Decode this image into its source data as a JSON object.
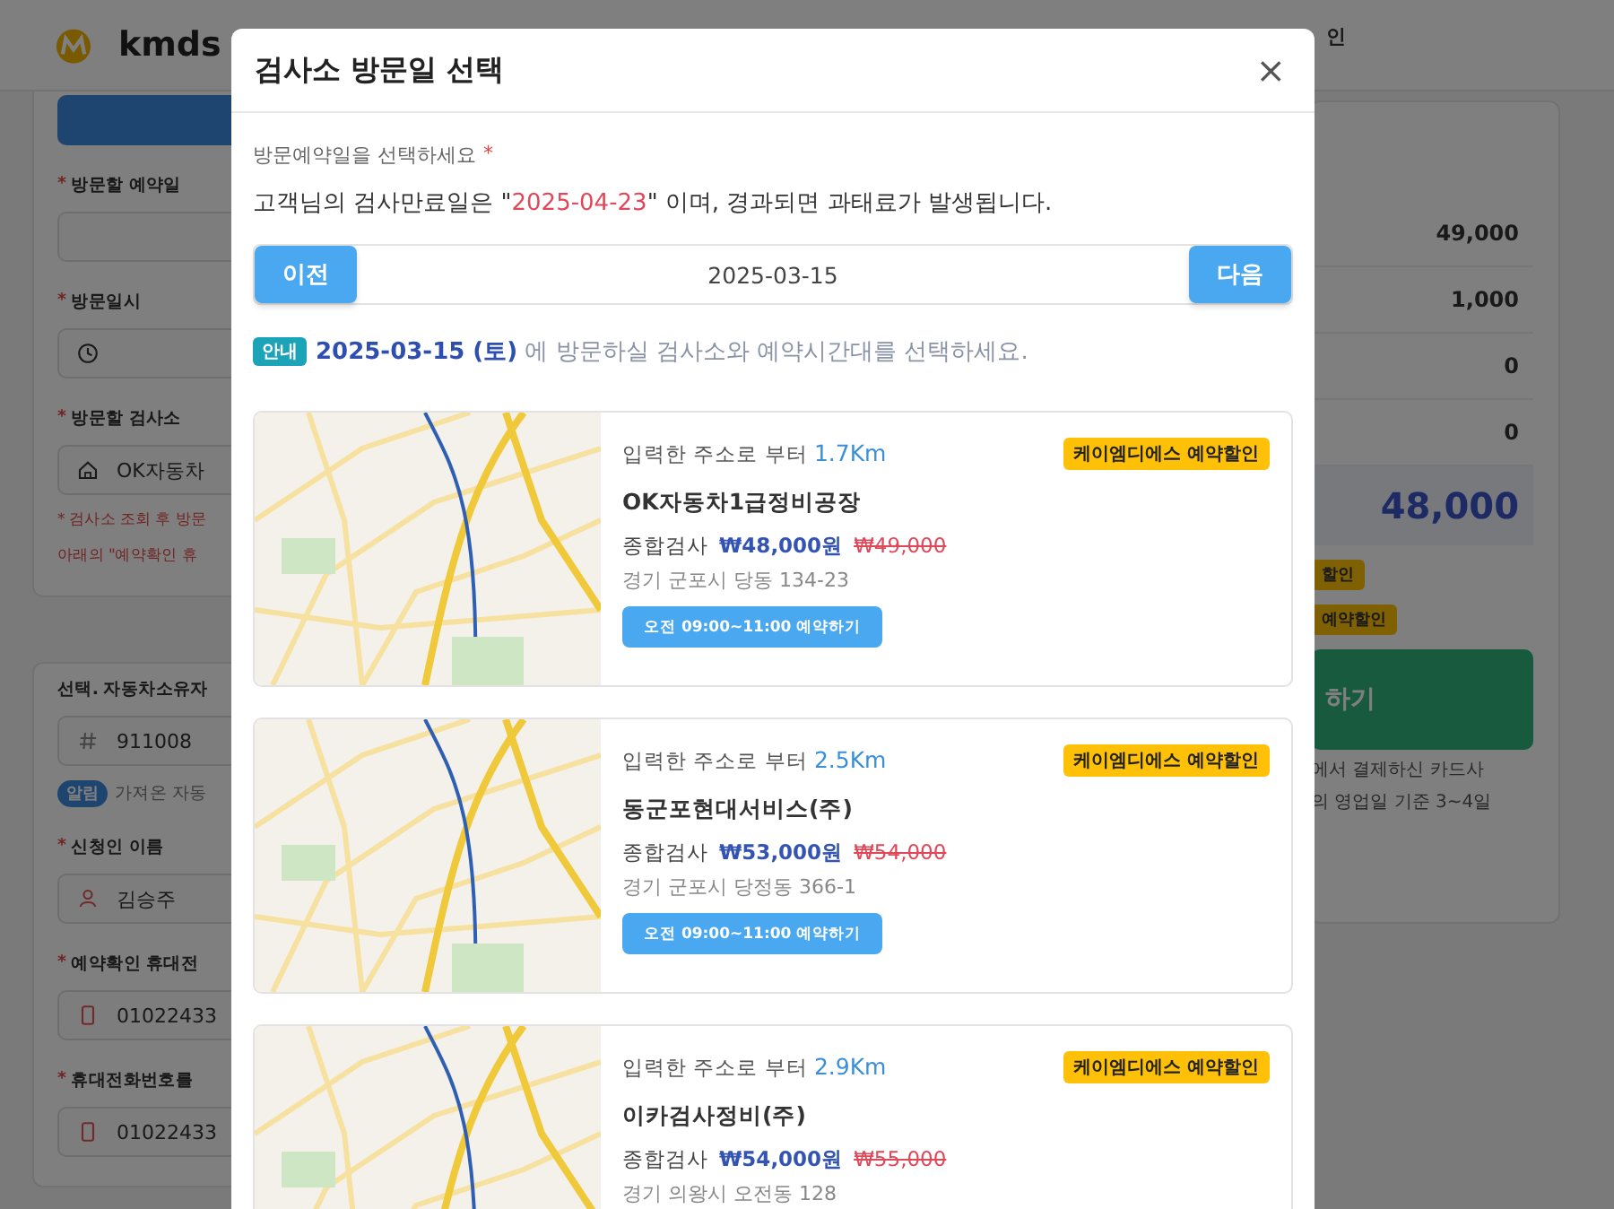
{
  "background": {
    "logo": "kmds",
    "header_right": "인",
    "sections": [
      {
        "fields": [
          {
            "kind": "bar"
          },
          {
            "kind": "label",
            "mark": "*",
            "text": "방문할 예약일"
          },
          {
            "kind": "date_input"
          },
          {
            "kind": "label",
            "mark": "*",
            "text": "방문일시"
          },
          {
            "kind": "time_input"
          },
          {
            "kind": "label",
            "mark": "*",
            "text": "방문할 검사소"
          },
          {
            "kind": "shop_input",
            "value": "OK자동차"
          },
          {
            "kind": "note",
            "text": "* 검사소 조회 후 방문"
          },
          {
            "kind": "note",
            "text": "아래의 \"예약확인 휴"
          }
        ]
      },
      {
        "fields": [
          {
            "kind": "label",
            "text": "선택. 자동차소유자"
          },
          {
            "kind": "number_input",
            "value": "911008"
          },
          {
            "kind": "alert",
            "badge": "알림",
            "text": "가져온 자동"
          },
          {
            "kind": "label",
            "mark": "*",
            "text": "신청인 이름"
          },
          {
            "kind": "name_input",
            "value": "김승주"
          },
          {
            "kind": "label",
            "mark": "*",
            "text": "예약확인 휴대전"
          },
          {
            "kind": "phone_input",
            "value": "01022433"
          },
          {
            "kind": "label",
            "mark": "*",
            "text": "휴대전화번호를"
          },
          {
            "kind": "phone_input",
            "value": "01022433"
          }
        ]
      }
    ],
    "summary": {
      "rows": [
        "49,000",
        "1,000",
        "0",
        "0"
      ],
      "total": "48,000",
      "badges": [
        "할인",
        "예약할인"
      ],
      "pay_button": "하기",
      "note_lines": [
        "에서 결제하신 카드사",
        "의 영업일 기준 3~4일"
      ]
    }
  },
  "modal": {
    "title": "검사소 방문일 선택",
    "close": "×",
    "prompt": {
      "text": "방문예약일을 선택하세요",
      "mark": "*"
    },
    "expiry": {
      "prefix": "고객님의 검사만료일은 \"",
      "date": "2025-04-23",
      "suffix": "\" 이며, 경과되면 과태료가 발생됩니다."
    },
    "date_nav": {
      "prev": "이전",
      "value": "2025-03-15",
      "next": "다음"
    },
    "info": {
      "badge": "안내",
      "text": "**2025-03-15 (토)** 에 방문하실 검사소와 예약시간대를 선택하세요."
    },
    "shops": [
      {
        "distance_label": "입력한 주소로 부터",
        "distance": "1.7Km",
        "badge": "케이엠디에스 예약할인",
        "name": "OK자동차1급정비공장",
        "service": "종합검사",
        "price": "₩48,000원",
        "original_price": "₩49,000",
        "address": "경기 군포시 당동 134-23",
        "slot_button": "오전 09:00~11:00 예약하기"
      },
      {
        "distance_label": "입력한 주소로 부터",
        "distance": "2.5Km",
        "badge": "케이엠디에스 예약할인",
        "name": "동군포현대서비스(주)",
        "service": "종합검사",
        "price": "₩53,000원",
        "original_price": "₩54,000",
        "address": "경기 군포시 당정동 366-1",
        "slot_button": "오전 09:00~11:00 예약하기"
      },
      {
        "distance_label": "입력한 주소로 부터",
        "distance": "2.9Km",
        "badge": "케이엠디에스 예약할인",
        "name": "이카검사정비(주)",
        "service": "종합검사",
        "price": "₩54,000원",
        "original_price": "₩55,000",
        "address": "경기 의왕시 오전동 128"
      }
    ]
  }
}
